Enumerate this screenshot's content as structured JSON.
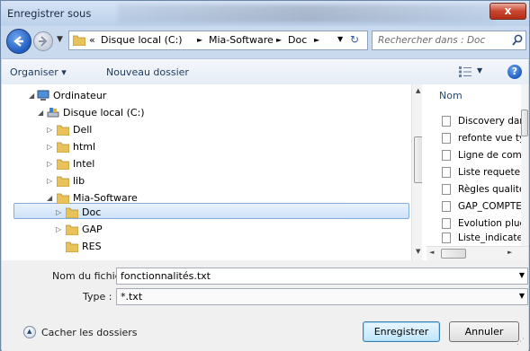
{
  "window": {
    "title": "Enregistrer sous",
    "close_label": "x"
  },
  "nav": {
    "breadcrumb": [
      "«",
      "Disque local (C:)",
      "►",
      "Mia-Software",
      "►",
      "Doc",
      "►"
    ],
    "search_placeholder": "Rechercher dans : Doc"
  },
  "toolbar": {
    "organize_label": "Organiser ▾",
    "new_folder_label": "Nouveau dossier",
    "help_label": "?"
  },
  "tree": {
    "items": [
      {
        "label": "Ordinateur"
      },
      {
        "label": "Disque local (C:)"
      },
      {
        "label": "Dell"
      },
      {
        "label": "html"
      },
      {
        "label": "Intel"
      },
      {
        "label": "lib"
      },
      {
        "label": "Mia-Software"
      },
      {
        "label": "Doc"
      },
      {
        "label": "GAP"
      },
      {
        "label": "RES"
      }
    ],
    "selected": "Doc"
  },
  "filelist": {
    "column_header": "Nom",
    "files": [
      "Discovery dans",
      "refonte vue typ",
      "Ligne de comm",
      "Liste requete st",
      "Règles qualité",
      "GAP_COMPTE",
      "Evolution plug",
      "Liste_indicateu"
    ]
  },
  "form": {
    "filename_label": "Nom du fichier :",
    "filename_value": "fonctionnalités.txt",
    "type_label": "Type :",
    "type_value": "*.txt",
    "hide_folders_label": "Cacher les dossiers",
    "save_label": "Enregistrer",
    "cancel_label": "Annuler"
  },
  "colors": {
    "selection": "#cde2f8",
    "chrome": "#c9d9ee",
    "link": "#1e395b"
  }
}
